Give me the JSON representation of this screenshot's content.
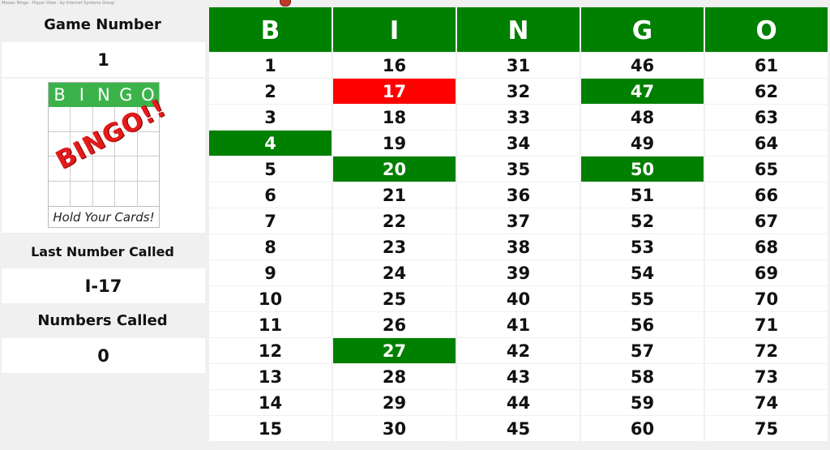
{
  "window": {
    "title": "Mosaic Bingo - Player View - by Internet Systems Group"
  },
  "sidebar": {
    "game_number_label": "Game Number",
    "game_number": "1",
    "card_letters": [
      "B",
      "I",
      "N",
      "G",
      "O"
    ],
    "stamp_text": "BINGO!!",
    "card_footer": "Hold Your Cards!",
    "last_called_label": "Last Number Called",
    "last_called": "I-17",
    "numbers_called_label": "Numbers Called",
    "numbers_called": "0"
  },
  "board": {
    "headers": [
      "B",
      "I",
      "N",
      "G",
      "O"
    ],
    "columns": [
      [
        "1",
        "2",
        "3",
        "4",
        "5",
        "6",
        "7",
        "8",
        "9",
        "10",
        "11",
        "12",
        "13",
        "14",
        "15"
      ],
      [
        "16",
        "17",
        "18",
        "19",
        "20",
        "21",
        "22",
        "23",
        "24",
        "25",
        "26",
        "27",
        "28",
        "29",
        "30"
      ],
      [
        "31",
        "32",
        "33",
        "34",
        "35",
        "36",
        "37",
        "38",
        "39",
        "40",
        "41",
        "42",
        "43",
        "44",
        "45"
      ],
      [
        "46",
        "47",
        "48",
        "49",
        "50",
        "51",
        "52",
        "53",
        "54",
        "55",
        "56",
        "57",
        "58",
        "59",
        "60"
      ],
      [
        "61",
        "62",
        "63",
        "64",
        "65",
        "66",
        "67",
        "68",
        "69",
        "70",
        "71",
        "72",
        "73",
        "74",
        "75"
      ]
    ],
    "called_numbers": [
      "4",
      "20",
      "27",
      "47",
      "50"
    ],
    "last_number": "17"
  },
  "colors": {
    "called": "#008000",
    "last": "#ff0000",
    "header": "#008000",
    "card_header": "#3cb34a"
  }
}
